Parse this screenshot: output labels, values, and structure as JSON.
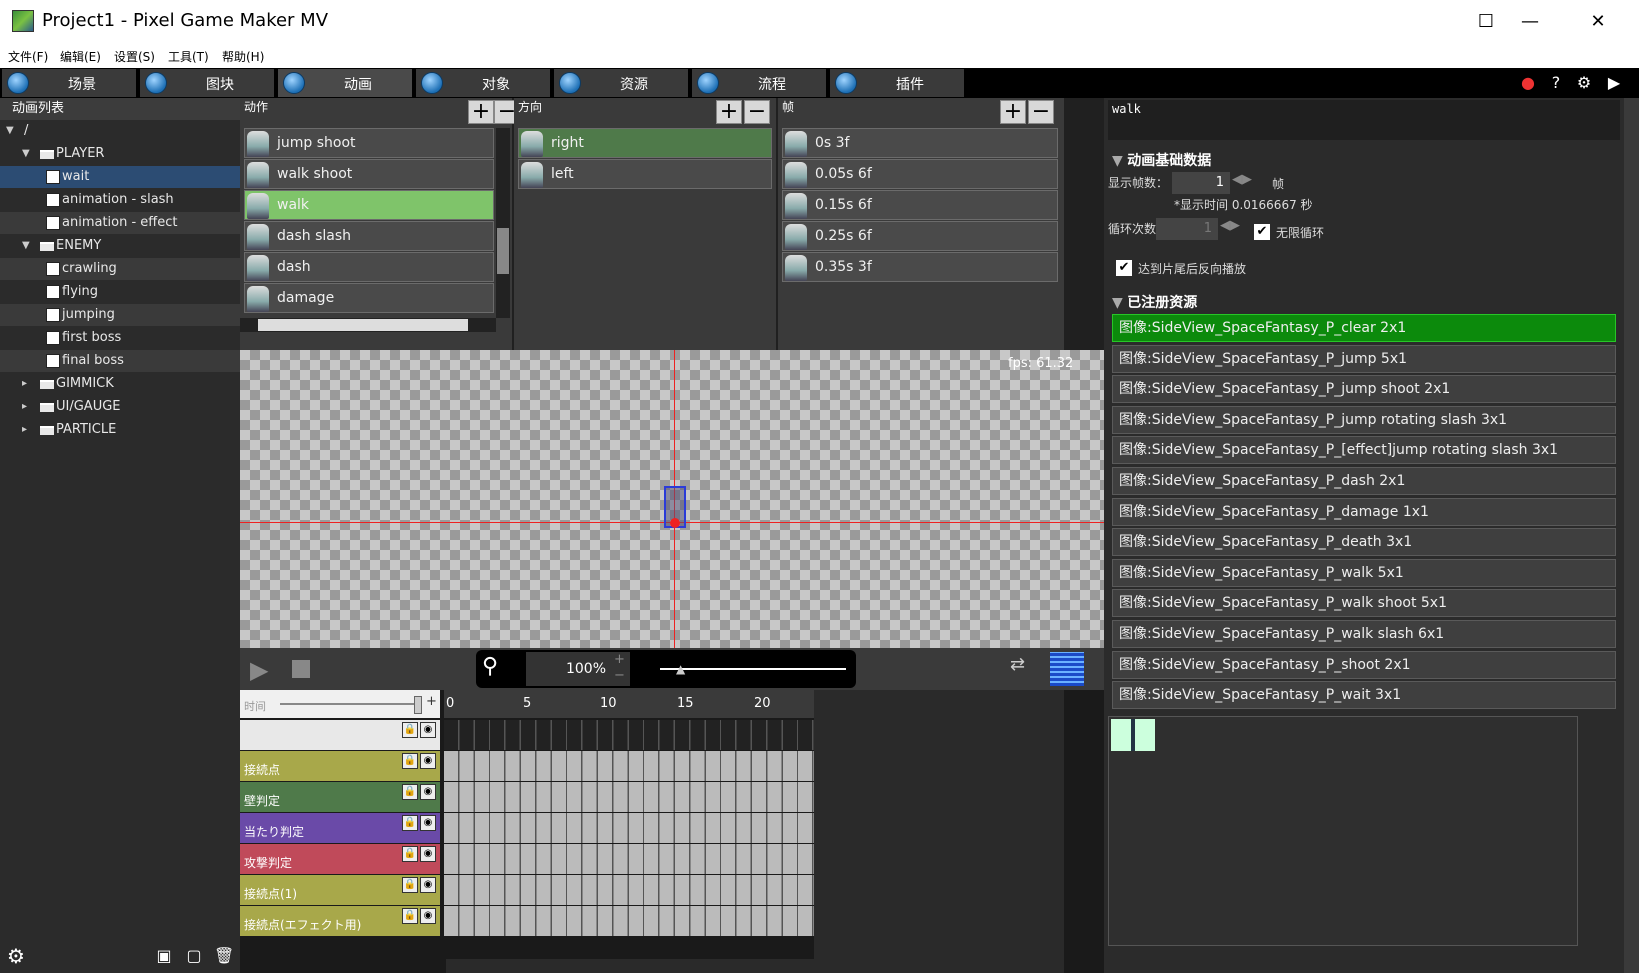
{
  "window": {
    "title": "Project1 - Pixel Game Maker MV",
    "minimize": "—",
    "maximize": "☐",
    "close": "✕"
  },
  "menu": [
    "文件(F)",
    "编辑(E)",
    "设置(S)",
    "工具(T)",
    "帮助(H)"
  ],
  "tabs": [
    {
      "label": "场景"
    },
    {
      "label": "图块"
    },
    {
      "label": "动画"
    },
    {
      "label": "对象"
    },
    {
      "label": "资源"
    },
    {
      "label": "流程"
    },
    {
      "label": "插件"
    }
  ],
  "left": {
    "title": "动画列表",
    "tree": [
      {
        "label": "/",
        "level": 0,
        "type": "root",
        "arrow": "▼"
      },
      {
        "label": "PLAYER",
        "level": 1,
        "type": "folder",
        "arrow": "▼"
      },
      {
        "label": "wait",
        "level": 2,
        "type": "anim",
        "selected": true
      },
      {
        "label": "animation - slash",
        "level": 2,
        "type": "anim"
      },
      {
        "label": "animation - effect",
        "level": 2,
        "type": "anim"
      },
      {
        "label": "ENEMY",
        "level": 1,
        "type": "folder",
        "arrow": "▼"
      },
      {
        "label": "crawling",
        "level": 2,
        "type": "anim"
      },
      {
        "label": "flying",
        "level": 2,
        "type": "anim"
      },
      {
        "label": "jumping",
        "level": 2,
        "type": "anim"
      },
      {
        "label": "first boss",
        "level": 2,
        "type": "anim"
      },
      {
        "label": "final boss",
        "level": 2,
        "type": "anim"
      },
      {
        "label": "GIMMICK",
        "level": 1,
        "type": "folder",
        "arrow": "▸"
      },
      {
        "label": "UI/GAUGE",
        "level": 1,
        "type": "folder",
        "arrow": "▸"
      },
      {
        "label": "PARTICLE",
        "level": 1,
        "type": "folder",
        "arrow": "▸"
      }
    ]
  },
  "actions": {
    "header": "动作",
    "items": [
      "jump shoot",
      "walk shoot",
      "walk",
      "dash slash",
      "dash",
      "damage"
    ],
    "selected": 2
  },
  "directions": {
    "header": "方向",
    "items": [
      "right",
      "left"
    ],
    "selected": 0
  },
  "frames": {
    "header": "帧",
    "items": [
      "0s 3f",
      "0.05s 6f",
      "0.15s 6f",
      "0.25s 6f",
      "0.35s 3f"
    ]
  },
  "canvas": {
    "fps": "fps: 61.32"
  },
  "playbar": {
    "zoom": "100%"
  },
  "timeline": {
    "time_label": "时间",
    "ticks": [
      "0",
      "5",
      "10",
      "15",
      "20"
    ],
    "layers": [
      {
        "name": "",
        "color": "#e8e8e8"
      },
      {
        "name": "接続点",
        "color": "#a8a84a"
      },
      {
        "name": "壁判定",
        "color": "#4f7a4a"
      },
      {
        "name": "当たり判定",
        "color": "#6a4aa8"
      },
      {
        "name": "攻撃判定",
        "color": "#c04a5a"
      },
      {
        "name": "接続点(1)",
        "color": "#a8a84a"
      },
      {
        "name": "接続点(エフェクト用)",
        "color": "#a8a84a"
      }
    ]
  },
  "right": {
    "name_value": "walk",
    "basic_section": "动画基础数据",
    "display_frames_label": "显示帧数：",
    "display_frames_value": "1",
    "frames_unit": "帧",
    "display_time": "*显示时间 0.0166667 秒",
    "loop_label": "循环次数",
    "loop_value": "1",
    "infinite_loop": "无限循环",
    "reverse_play": "达到片尾后反向播放",
    "registered_section": "已注册资源",
    "resources": [
      "图像:SideView_SpaceFantasy_P_clear 2x1",
      "图像:SideView_SpaceFantasy_P_jump 5x1",
      "图像:SideView_SpaceFantasy_P_jump shoot 2x1",
      "图像:SideView_SpaceFantasy_P_jump rotating slash 3x1",
      "图像:SideView_SpaceFantasy_P_[effect]jump rotating slash 3x1",
      "图像:SideView_SpaceFantasy_P_dash 2x1",
      "图像:SideView_SpaceFantasy_P_damage 1x1",
      "图像:SideView_SpaceFantasy_P_death 3x1",
      "图像:SideView_SpaceFantasy_P_walk 5x1",
      "图像:SideView_SpaceFantasy_P_walk shoot 5x1",
      "图像:SideView_SpaceFantasy_P_walk slash 6x1",
      "图像:SideView_SpaceFantasy_P_shoot 2x1",
      "图像:SideView_SpaceFantasy_P_wait 3x1"
    ]
  }
}
